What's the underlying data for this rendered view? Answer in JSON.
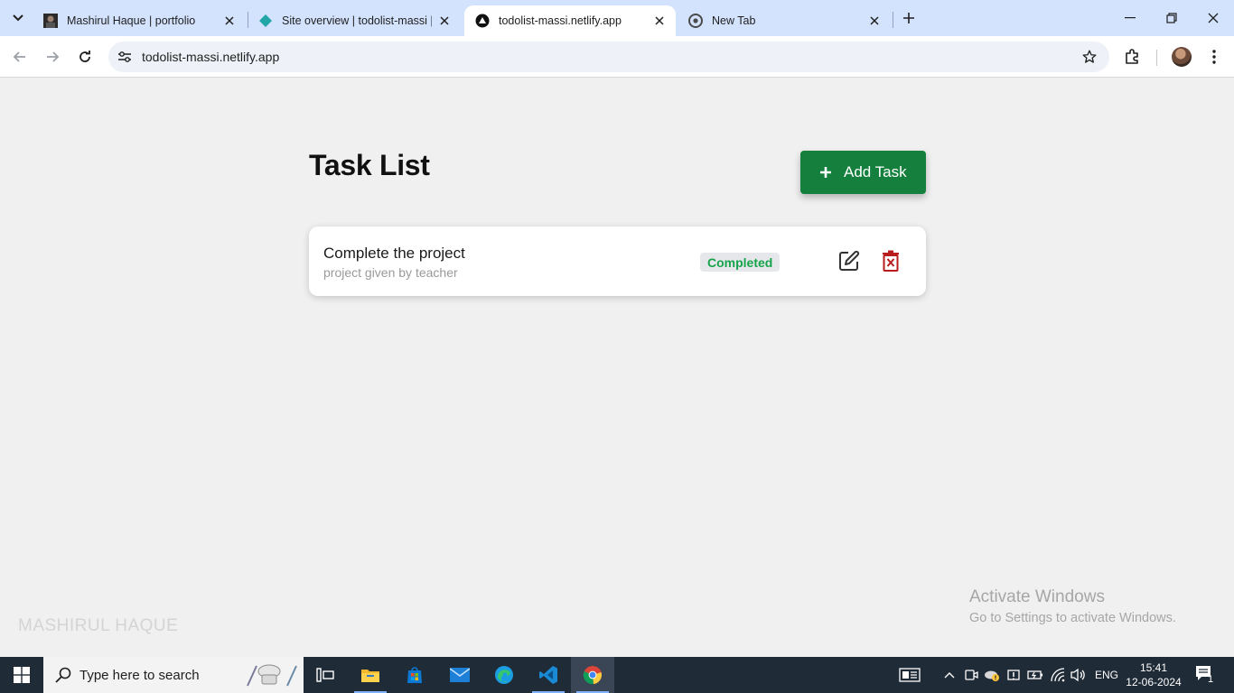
{
  "browser": {
    "tabs": [
      {
        "title": "Mashirul Haque | portfolio",
        "favicon": "portrait-favicon"
      },
      {
        "title": "Site overview | todolist-massi | N",
        "favicon": "netlify-favicon"
      },
      {
        "title": "todolist-massi.netlify.app",
        "favicon": "triangle-favicon",
        "active": true
      },
      {
        "title": "New Tab",
        "favicon": "chrome-favicon"
      }
    ],
    "url": "todolist-massi.netlify.app"
  },
  "page": {
    "title": "Task List",
    "add_button_label": "Add Task",
    "tasks": [
      {
        "title": "Complete the project",
        "description": "project given by teacher",
        "status": "Completed"
      }
    ],
    "watermark": "MASHIRUL HAQUE",
    "colors": {
      "primary": "#15803d",
      "status_completed": "#16a34a",
      "delete": "#b91c1c"
    }
  },
  "windows_notice": {
    "line1": "Activate Windows",
    "line2": "Go to Settings to activate Windows."
  },
  "taskbar": {
    "search_placeholder": "Type here to search",
    "language": "ENG",
    "time": "15:41",
    "date": "12-06-2024",
    "notification_count": "1"
  }
}
